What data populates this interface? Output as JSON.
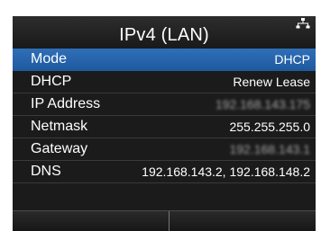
{
  "header": {
    "title": "IPv4 (LAN)",
    "network_icon": "network-icon"
  },
  "colors": {
    "background": "#1b1b1b",
    "selected_row": "#2466ad",
    "text": "#ffffff"
  },
  "rows": [
    {
      "label": "Mode",
      "value": "DHCP",
      "selected": true
    },
    {
      "label": "DHCP",
      "value": "Renew Lease",
      "selected": false
    },
    {
      "label": "IP Address",
      "value": "192.168.143.175",
      "selected": false,
      "obscured": true
    },
    {
      "label": "Netmask",
      "value": "255.255.255.0",
      "selected": false
    },
    {
      "label": "Gateway",
      "value": "192.168.143.1",
      "selected": false,
      "obscured": true
    },
    {
      "label": "DNS",
      "value": "192.168.143.2, 192.168.148.2",
      "selected": false
    }
  ],
  "softkeys": [
    {
      "label": ""
    },
    {
      "label": ""
    }
  ]
}
